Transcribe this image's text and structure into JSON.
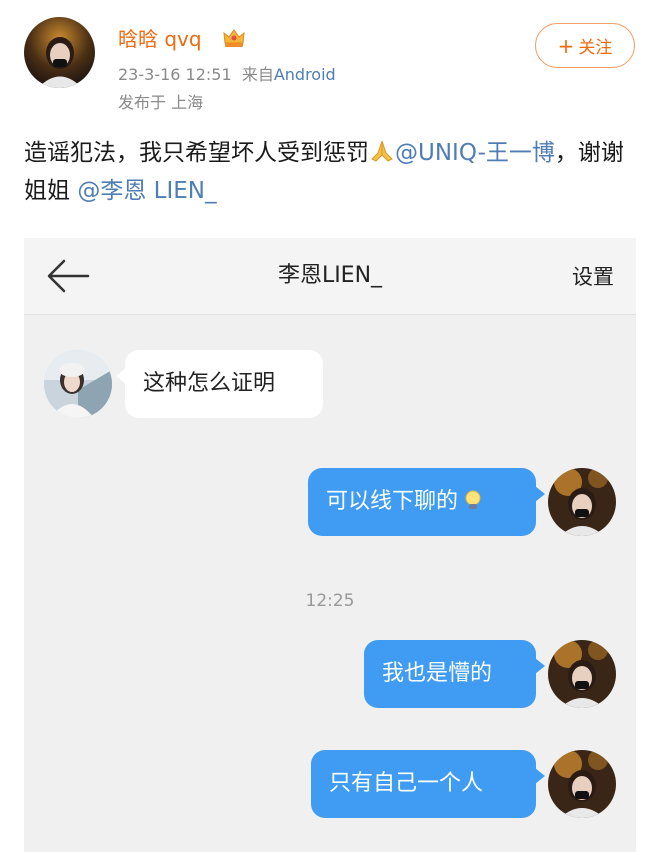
{
  "post": {
    "username": "晗晗 qvq",
    "badge_icon": "crown-icon",
    "date_time": "23-3-16 12:51",
    "source_prefix": "来自",
    "source": "Android",
    "location": "发布于 上海",
    "follow_plus": "+",
    "follow_label": "关注",
    "text_part1": "造谣犯法，我只希望坏人受到惩罚",
    "pray_icon": "pray-icon",
    "mention1": "@UNIQ-王一博",
    "text_part2": "，谢谢姐姐",
    "mention2": "@李恩 LIEN_"
  },
  "chat": {
    "title": "李恩LIEN_",
    "settings_label": "设置",
    "back_icon": "back-arrow-icon",
    "messages": [
      {
        "side": "in",
        "text": "这种怎么证明"
      },
      {
        "side": "out",
        "text": "可以线下聊的",
        "emoji": "light-bulb-emoji-icon"
      },
      {
        "side": "out",
        "text": "我也是懵的"
      },
      {
        "side": "out",
        "text": "只有自己一个人"
      }
    ],
    "timestamp": "12:25"
  },
  "colors": {
    "username": "#f06a10",
    "mention": "#4f7db6",
    "bubble_out": "#3f9cf2",
    "chat_bg": "#f0f0f0"
  }
}
